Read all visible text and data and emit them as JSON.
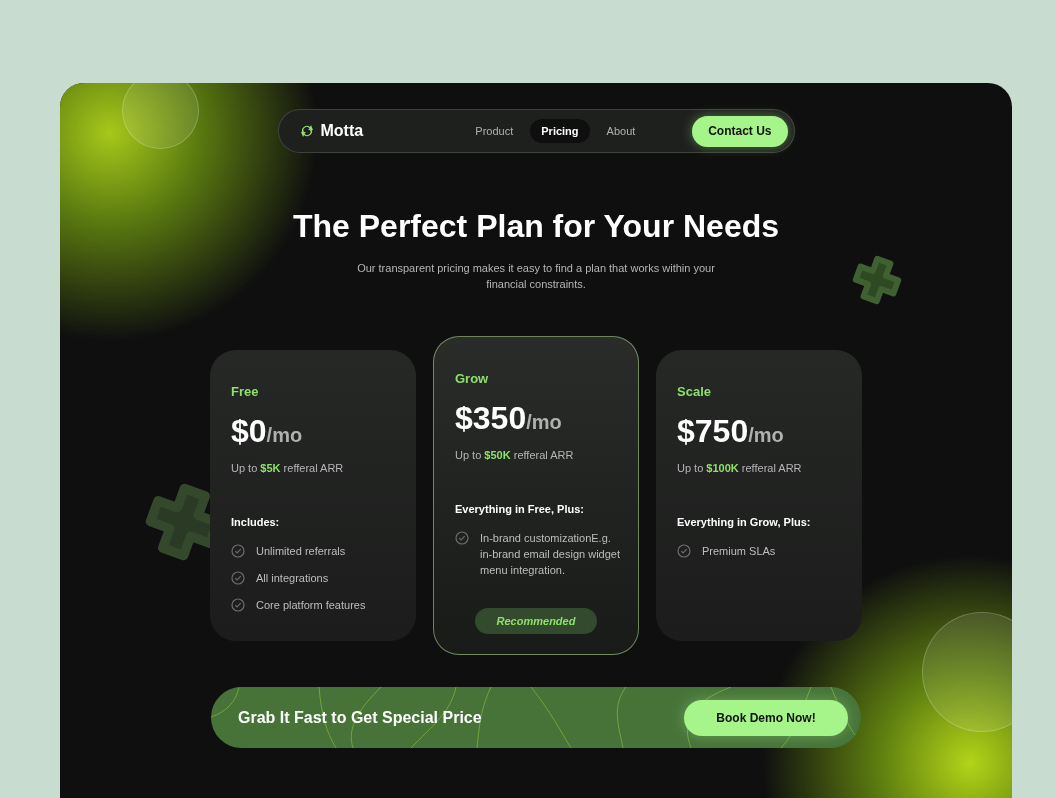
{
  "nav": {
    "logo": "Motta",
    "links": [
      {
        "label": "Product",
        "selected": false
      },
      {
        "label": "Pricing",
        "selected": true
      },
      {
        "label": "About",
        "selected": false
      }
    ],
    "cta": "Contact Us"
  },
  "hero": {
    "title": "The Perfect Plan for Your Needs",
    "subtitle": "Our transparent pricing makes it easy to find a plan that works within your financial constraints."
  },
  "plans": [
    {
      "name": "Free",
      "price": "$0",
      "period": "/mo",
      "arr": "Up to **$5K** refferal ARR",
      "features_heading": "Includes:",
      "features": [
        "Unlimited referrals",
        "All integrations",
        "Core platform features"
      ],
      "highlighted": false
    },
    {
      "name": "Grow",
      "price": "$350",
      "period": "/mo",
      "arr": "Up to **$50K** refferal ARR",
      "features_heading": "Everything in Free, Plus:",
      "features": [
        "In-brand customizationE.g. in-brand email design widget menu integration."
      ],
      "highlighted": true,
      "badge": "Recommended"
    },
    {
      "name": "Scale",
      "price": "$750",
      "period": "/mo",
      "arr": "Up to **$100K** refferal ARR",
      "features_heading": "Everything in Grow, Plus:",
      "features": [
        "Premium SLAs"
      ],
      "highlighted": false
    }
  ],
  "banner": {
    "text": "Grab It Fast to Get Special Price",
    "button": "Book Demo Now!"
  }
}
